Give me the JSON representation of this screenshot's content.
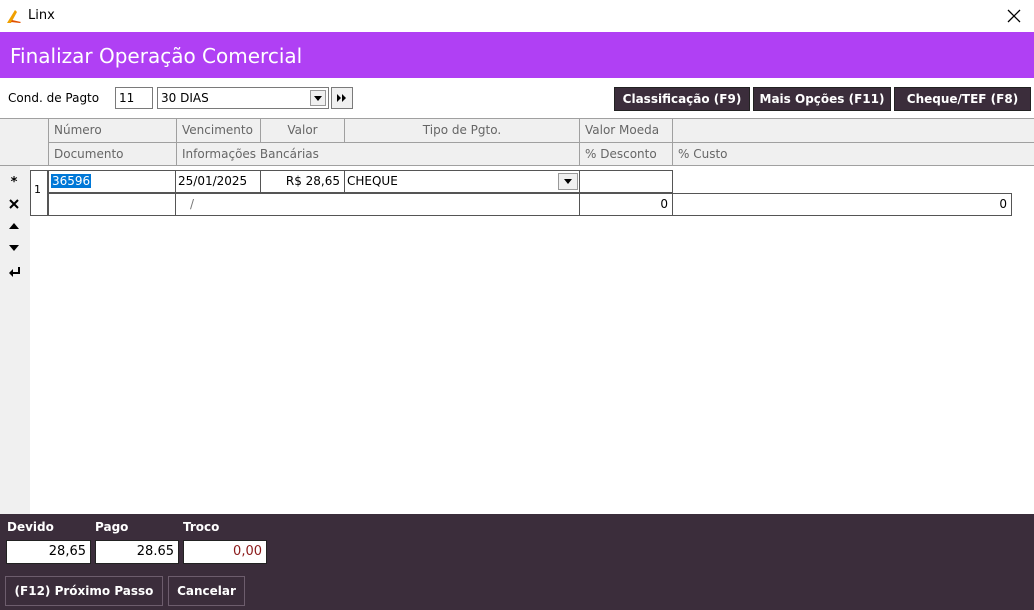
{
  "window": {
    "title": "Linx",
    "accent": "#b040f4"
  },
  "header": {
    "title": "Finalizar Operação Comercial"
  },
  "toolbar": {
    "cond_label": "Cond. de Pagto",
    "cond_code": "11",
    "cond_value": "30 DIAS",
    "classificacao_label": "Classificação (F9)",
    "mais_opcoes_label": "Mais Opções (F11)",
    "cheque_tef_label": "Cheque/TEF (F8)"
  },
  "grid": {
    "headers_row1": [
      "Número",
      "Vencimento",
      "Valor",
      "Tipo de Pgto.",
      "Valor Moeda"
    ],
    "headers_row2": [
      "Documento",
      "Informações Bancárias",
      "% Desconto",
      "% Custo"
    ],
    "side_icons": [
      "asterisk-icon",
      "delete-icon",
      "move-up-icon",
      "move-down-icon",
      "enter-icon"
    ],
    "rows": [
      {
        "index": "1",
        "numero": "36596",
        "vencimento": "25/01/2025",
        "valor": "R$ 28,65",
        "tipo": "CHEQUE",
        "valor_moeda": "",
        "documento": "",
        "info_bancarias": "/",
        "desconto": "0",
        "custo": "0"
      }
    ]
  },
  "footer": {
    "devido_label": "Devido",
    "pago_label": "Pago",
    "troco_label": "Troco",
    "devido_value": "28,65",
    "pago_value": "28.65",
    "troco_value": "0,00",
    "next_label": "(F12) Próximo Passo",
    "cancel_label": "Cancelar"
  }
}
